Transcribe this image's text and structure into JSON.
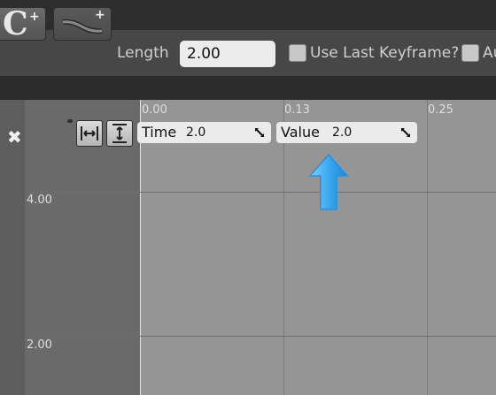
{
  "toolbar": {
    "length_label": "Length",
    "length_value": "2.00",
    "use_last_keyframe_label": "Use Last Keyframe?",
    "auto_label": "Au",
    "curve_c_glyph": "C",
    "plus_glyph": "+"
  },
  "graph": {
    "x_ticks": [
      "0.00",
      "0.13",
      "0.25"
    ],
    "y_ticks": [
      "4.00",
      "2.00"
    ],
    "time_label": "Time",
    "time_value": "2.0",
    "value_label": "Value",
    "value_value": "2.0"
  },
  "icons": {
    "close": "close-icon",
    "fit_horizontal": "fit-horizontal-icon",
    "fit_vertical": "fit-vertical-icon",
    "expand": "expand-icon",
    "arrow": "up-arrow-icon"
  },
  "colors": {
    "graph_bg": "#959595",
    "panel_bg": "#6a6a6a",
    "arrow": "#3aa8f0",
    "field_bg": "#ebebeb"
  }
}
